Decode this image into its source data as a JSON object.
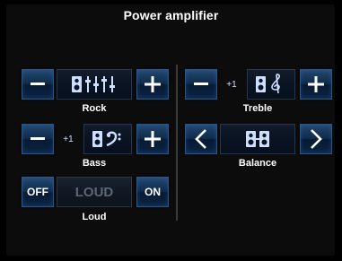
{
  "title": "Power amplifier",
  "rock": {
    "label": "Rock"
  },
  "bass": {
    "label": "Bass",
    "value": "+1"
  },
  "loud": {
    "label": "Loud",
    "off_label": "OFF",
    "on_label": "ON",
    "display_text": "LOUD"
  },
  "treble": {
    "label": "Treble",
    "value": "+1"
  },
  "balance": {
    "label": "Balance"
  },
  "colors": {
    "accent": "#2a5686",
    "button_top": "#23486f",
    "button_bottom": "#071a33",
    "icon_blue": "#7fb3ff"
  }
}
